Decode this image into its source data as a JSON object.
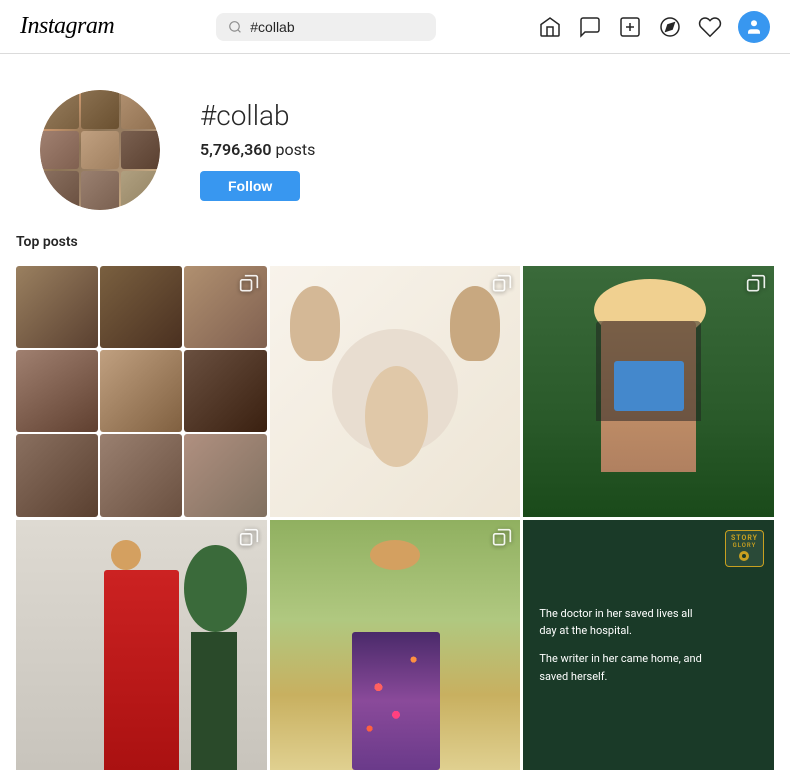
{
  "app": {
    "name": "Instagram"
  },
  "nav": {
    "search_placeholder": "#collab",
    "search_value": "#collab"
  },
  "nav_icons": [
    {
      "name": "home-icon",
      "symbol": "🏠"
    },
    {
      "name": "messenger-icon",
      "symbol": "💬"
    },
    {
      "name": "new-post-icon",
      "symbol": "+"
    },
    {
      "name": "explore-icon",
      "symbol": "🧭"
    },
    {
      "name": "heart-icon",
      "symbol": "♡"
    },
    {
      "name": "profile-icon",
      "symbol": "👤"
    }
  ],
  "profile": {
    "handle": "#collab",
    "posts_count": "5,796,360",
    "posts_label": "posts",
    "follow_label": "Follow"
  },
  "sections": {
    "top_posts_label": "Top posts"
  },
  "posts": [
    {
      "id": 1,
      "type": "meat",
      "multi": true,
      "alt": "Meat packages flat lay"
    },
    {
      "id": 2,
      "type": "baby",
      "multi": true,
      "alt": "Baby with plush toys"
    },
    {
      "id": 3,
      "type": "woman",
      "multi": true,
      "alt": "Blonde woman in blue outfit"
    },
    {
      "id": 4,
      "type": "red-dress",
      "multi": true,
      "alt": "Woman in red dress with plant"
    },
    {
      "id": 5,
      "type": "floral",
      "multi": true,
      "alt": "Woman in floral skirt in field"
    },
    {
      "id": 6,
      "type": "dark",
      "multi": false,
      "alt": "Inspirational quote dark background",
      "logo_line1": "STORY",
      "logo_line2": "GLORY",
      "text_line1": "The doctor in her saved lives all day at the hospital.",
      "text_line2": "The writer in her came home, and saved herself."
    }
  ],
  "dark_post": {
    "logo_line1": "STORY",
    "logo_line2": "GLORY",
    "quote_part1": "The doctor in her saved lives all day at the hospital.",
    "quote_part2": "The writer in her came home, and saved herself."
  }
}
